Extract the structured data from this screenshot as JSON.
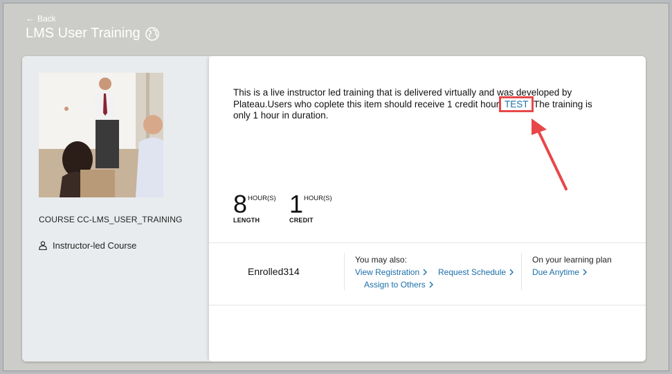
{
  "header": {
    "back_label": "Back",
    "title": "LMS User Training"
  },
  "course": {
    "code": "COURSE CC-LMS_USER_TRAINING",
    "type": "Instructor-led Course"
  },
  "description": {
    "part1": "This is a live instructor led training that is delivered virtually and was developed by Plateau.Users who coplete this item should receive 1 credit hour",
    "link": "TEST",
    "part2": "The training is only 1 hour in duration."
  },
  "stats": {
    "length": {
      "value": "8",
      "unit": "HOUR(S)",
      "label": "LENGTH"
    },
    "credit": {
      "value": "1",
      "unit": "HOUR(S)",
      "label": "CREDIT"
    }
  },
  "status": {
    "enrolled": "Enrolled314"
  },
  "actions": {
    "title": "You may also:",
    "view_registration": "View Registration",
    "request_schedule": "Request Schedule",
    "assign_to_others": "Assign to Others"
  },
  "learning_plan": {
    "title": "On your learning plan",
    "due": "Due Anytime"
  },
  "colors": {
    "link": "#1a6fa8",
    "highlight": "#e8474a"
  }
}
